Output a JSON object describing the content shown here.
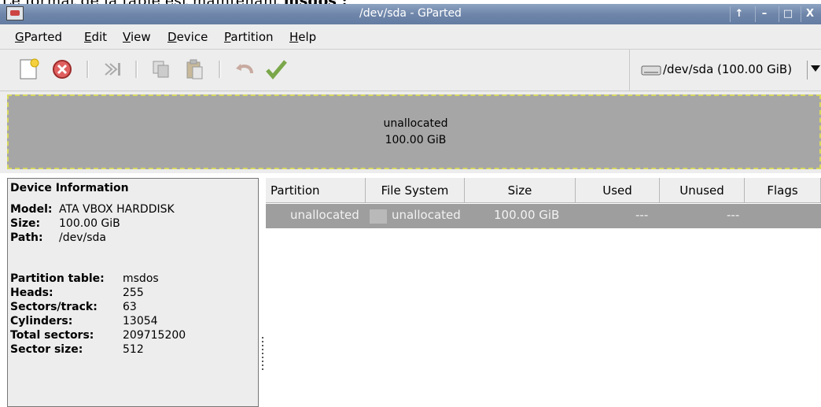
{
  "caption": {
    "text": "Le format de la table est maintenant ",
    "bold": "msdos :"
  },
  "window": {
    "title": "/dev/sda - GParted",
    "btn_up": "↑",
    "btn_min": "–",
    "btn_max": "□",
    "btn_close": "X"
  },
  "menu": {
    "gparted": {
      "u": "G",
      "rest": "Parted"
    },
    "edit": {
      "u": "E",
      "rest": "dit"
    },
    "view": {
      "u": "V",
      "rest": "iew"
    },
    "device": {
      "u": "D",
      "rest": "evice"
    },
    "partition": {
      "u": "P",
      "rest": "artition"
    },
    "help": {
      "u": "H",
      "rest": "elp"
    }
  },
  "toolbar": {
    "icons": [
      "new-icon",
      "delete-icon",
      "resize-icon",
      "copy-icon",
      "paste-icon",
      "undo-icon",
      "apply-icon"
    ],
    "device": "/dev/sda  (100.00 GiB)"
  },
  "disk": {
    "label": "unallocated",
    "size": "100.00 GiB"
  },
  "device_info": {
    "title": "Device Information",
    "model_label": "Model:",
    "model": "ATA VBOX HARDDISK",
    "size_label": "Size:",
    "size": "100.00 GiB",
    "path_label": "Path:",
    "path": "/dev/sda",
    "ptable_label": "Partition table:",
    "ptable": "msdos",
    "heads_label": "Heads:",
    "heads": "255",
    "sectors_track_label": "Sectors/track:",
    "sectors_track": "63",
    "cylinders_label": "Cylinders:",
    "cylinders": "13054",
    "total_sectors_label": "Total sectors:",
    "total_sectors": "209715200",
    "sector_size_label": "Sector size:",
    "sector_size": "512"
  },
  "table": {
    "headers": [
      "Partition",
      "File System",
      "Size",
      "Used",
      "Unused",
      "Flags"
    ],
    "rows": [
      {
        "partition": "unallocated",
        "fs": "unallocated",
        "size": "100.00 GiB",
        "used": "---",
        "unused": "---",
        "flags": ""
      }
    ]
  },
  "colors": {
    "titlebar": "#6f86aa",
    "selected_row": "#9e9e9e",
    "disk_bar": "#a6a6a6",
    "disk_border": "#d8d860"
  }
}
